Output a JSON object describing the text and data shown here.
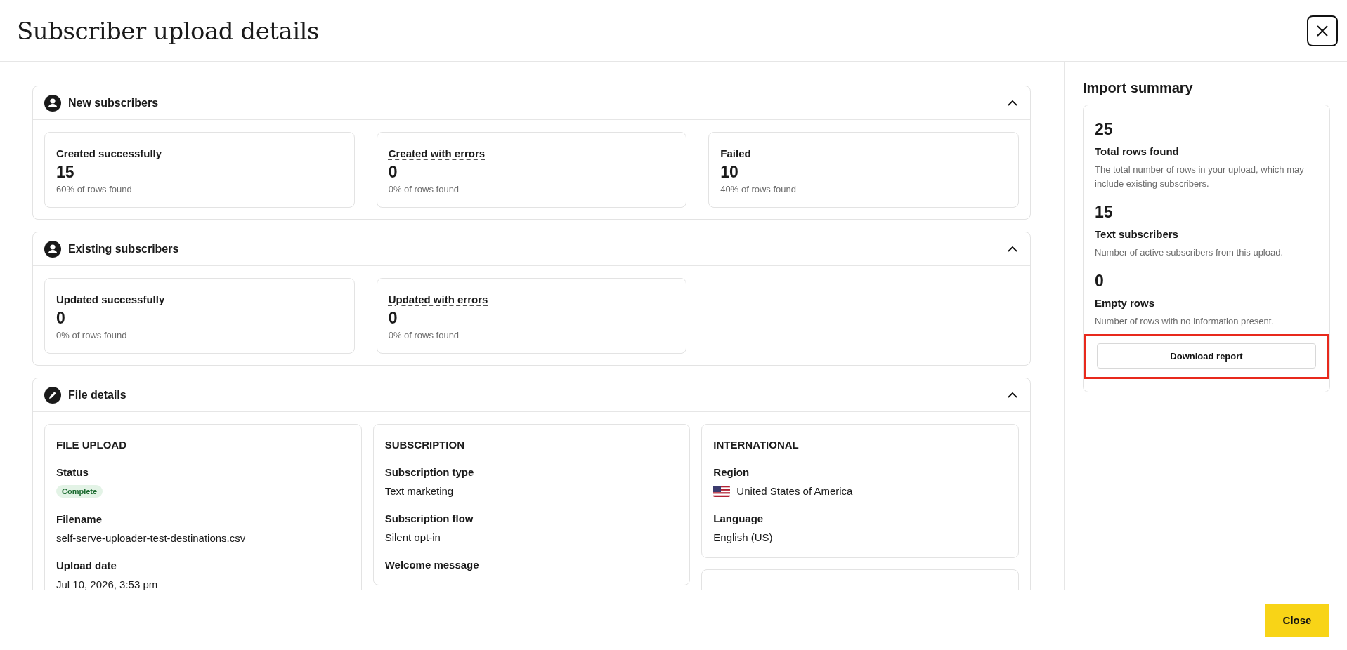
{
  "dialog": {
    "title": "Subscriber upload details"
  },
  "sections": [
    {
      "title": "New subscribers",
      "expanded": true,
      "stats": [
        {
          "label": "Created successfully",
          "value": "15",
          "note": "60% of rows found",
          "has_tooltip": false
        },
        {
          "label": "Created with errors",
          "value": "0",
          "note": "0% of rows found",
          "has_tooltip": true
        },
        {
          "label": "Failed",
          "value": "10",
          "note": "40% of rows found",
          "has_tooltip": false
        }
      ]
    },
    {
      "title": "Existing subscribers",
      "expanded": true,
      "stats": [
        {
          "label": "Updated successfully",
          "value": "0",
          "note": "0% of rows found",
          "has_tooltip": false
        },
        {
          "label": "Updated with errors",
          "value": "0",
          "note": "0% of rows found",
          "has_tooltip": true
        }
      ]
    }
  ],
  "file_details": {
    "title": "File details",
    "expanded": true,
    "groups": [
      {
        "heading": "FILE UPLOAD",
        "fields": [
          {
            "label": "Status",
            "kind": "badge",
            "value": "Complete"
          },
          {
            "label": "Filename",
            "kind": "text",
            "value": "self-serve-uploader-test-destinations.csv"
          },
          {
            "label": "Upload date",
            "kind": "text",
            "value": "Jul 10, 2026, 3:53 pm"
          }
        ]
      },
      {
        "heading": "SUBSCRIPTION",
        "fields": [
          {
            "label": "Subscription type",
            "kind": "text",
            "value": "Text marketing"
          },
          {
            "label": "Subscription flow",
            "kind": "text",
            "value": "Silent opt-in"
          },
          {
            "label": "Welcome message"
          }
        ]
      },
      {
        "heading": "INTERNATIONAL",
        "fields": [
          {
            "label": "Region",
            "kind": "flag",
            "value": "United States of America"
          },
          {
            "label": "Language",
            "kind": "text",
            "value": "English (US)"
          }
        ]
      }
    ]
  },
  "summary": {
    "title": "Import summary",
    "items": [
      {
        "value": "25",
        "label": "Total rows found",
        "description": "The total number of rows in your upload, which may include existing subscribers."
      },
      {
        "value": "15",
        "label": "Text subscribers",
        "description": "Number of active subscribers from this upload."
      },
      {
        "value": "0",
        "label": "Empty rows",
        "description": "Number of rows with no information present."
      }
    ],
    "button": {
      "label": "Download report",
      "highlighted": true
    }
  },
  "footer": {
    "close_button": "Close"
  }
}
